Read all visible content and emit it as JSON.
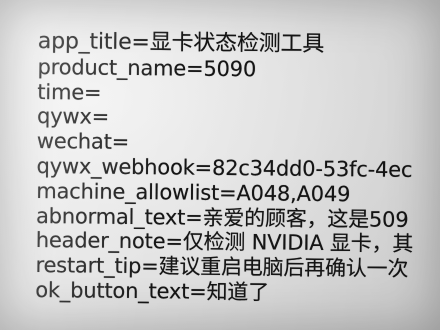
{
  "config": {
    "lines": [
      "app_title=显卡状态检测工具",
      "product_name=5090",
      "time=",
      "qywx=",
      "wechat=",
      "qywx_webhook=82c34dd0-53fc-4ec",
      "machine_allowlist=A048,A049",
      "abnormal_text=亲爱的顾客，这是509",
      "header_note=仅检测 NVIDIA 显卡，其",
      "restart_tip=建议重启电脑后再确认一次",
      "ok_button_text=知道了"
    ]
  }
}
